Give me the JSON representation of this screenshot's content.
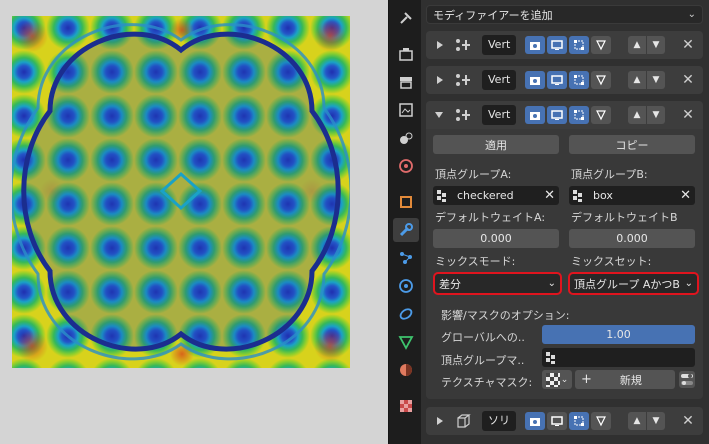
{
  "panel": {
    "add_modifier_label": "モディファイアーを追加"
  },
  "modifiers": [
    {
      "name": "Vert",
      "expanded": false
    },
    {
      "name": "Vert",
      "expanded": false
    },
    {
      "name": "Vert",
      "expanded": true
    },
    {
      "name": "ソリ",
      "expanded": false
    }
  ],
  "expanded_modifier": {
    "apply_label": "適用",
    "copy_label": "コピー",
    "vertex_group_a_label": "頂点グループA:",
    "vertex_group_b_label": "頂点グループB:",
    "vertex_group_a_value": "checkered",
    "vertex_group_b_value": "box",
    "default_weight_a_label": "デフォルトウェイトA:",
    "default_weight_b_label": "デフォルトウェイトB",
    "default_weight_a_value": "0.000",
    "default_weight_b_value": "0.000",
    "mix_mode_label": "ミックスモード:",
    "mix_set_label": "ミックスセット:",
    "mix_mode_value": "差分",
    "mix_set_value": "頂点グループ AかつB",
    "influence_header": "影響/マスクのオプション:",
    "global_influence_label": "グローバルへの..",
    "global_influence_value": "1.00",
    "global_influence_fraction": 1.0,
    "vertex_group_mask_label": "頂点グループマ..",
    "texture_mask_label": "テクスチャマスク:",
    "new_label": "新規"
  },
  "colors": {
    "accent": "#4772b3",
    "highlight_outline": "#e0141e",
    "panel_bg": "#303030",
    "viewport_bg": "#d4d4d4"
  },
  "tabs": [
    "tool-icon",
    "render-icon",
    "output-icon",
    "view-layer-icon",
    "scene-icon",
    "world-icon",
    "object-icon",
    "modifier-icon",
    "particles-icon",
    "physics-icon",
    "constraints-icon",
    "data-icon",
    "material-icon",
    "texture-icon"
  ]
}
